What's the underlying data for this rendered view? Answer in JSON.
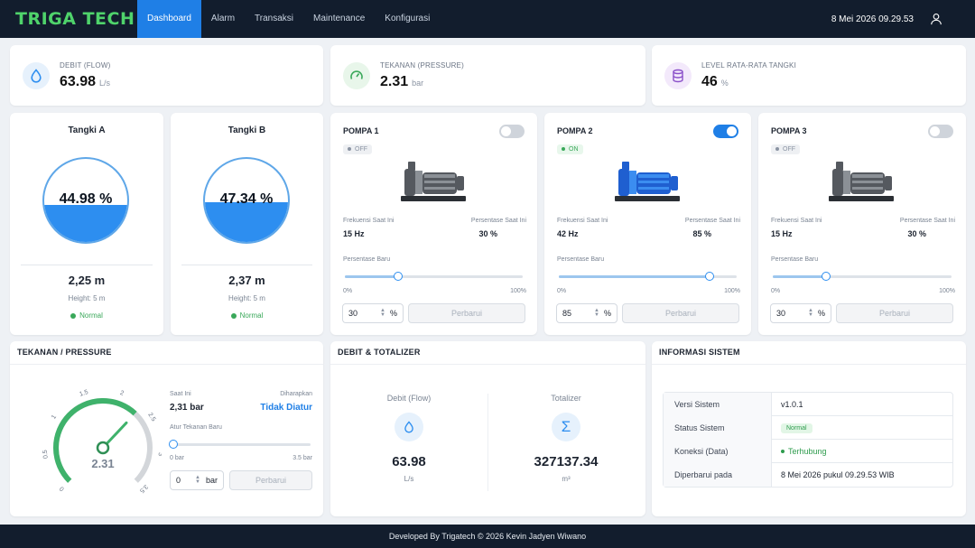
{
  "nav": {
    "brand": "TRIGA TECH",
    "items": [
      "Dashboard",
      "Alarm",
      "Transaksi",
      "Maintenance",
      "Konfigurasi"
    ],
    "datetime": "8 Mei 2026 09.29.53"
  },
  "stats": [
    {
      "label": "DEBIT (FLOW)",
      "value": "63.98",
      "unit": "L/s",
      "icon": "droplet-icon",
      "color": "#2d8ef0"
    },
    {
      "label": "TEKANAN (PRESSURE)",
      "value": "2.31",
      "unit": "bar",
      "icon": "gauge-icon",
      "color": "#3aa85a"
    },
    {
      "label": "LEVEL RATA-RATA TANGKI",
      "value": "46",
      "unit": "%",
      "icon": "database-icon",
      "color": "#8a4fc9"
    }
  ],
  "tanks": [
    {
      "title": "Tangki A",
      "percent": "44.98 %",
      "level": 0.4498,
      "height": "2,25 m",
      "capacity": "Height: 5 m",
      "status": "Normal"
    },
    {
      "title": "Tangki B",
      "percent": "47.34 %",
      "level": 0.4734,
      "height": "2,37 m",
      "capacity": "Height: 5 m",
      "status": "Normal"
    }
  ],
  "pumps": [
    {
      "title": "POMPA 1",
      "state": "OFF",
      "on": false,
      "freq_label": "Frekuensi Saat Ini",
      "freq": "15 Hz",
      "pct_label": "Persentase Saat Ini",
      "pct": "30 %",
      "new_label": "Persentase Baru",
      "slider": 0.3,
      "min": "0%",
      "max": "100%",
      "input": "30",
      "unit": "%",
      "button": "Perbarui"
    },
    {
      "title": "POMPA 2",
      "state": "ON",
      "on": true,
      "freq_label": "Frekuensi Saat Ini",
      "freq": "42 Hz",
      "pct_label": "Persentase Saat Ini",
      "pct": "85 %",
      "new_label": "Persentase Baru",
      "slider": 0.85,
      "min": "0%",
      "max": "100%",
      "input": "85",
      "unit": "%",
      "button": "Perbarui"
    },
    {
      "title": "POMPA 3",
      "state": "OFF",
      "on": false,
      "freq_label": "Frekuensi Saat Ini",
      "freq": "15 Hz",
      "pct_label": "Persentase Saat Ini",
      "pct": "30 %",
      "new_label": "Persentase Baru",
      "slider": 0.3,
      "min": "0%",
      "max": "100%",
      "input": "30",
      "unit": "%",
      "button": "Perbarui"
    }
  ],
  "pressure": {
    "title": "TEKANAN / PRESSURE",
    "gauge_value": "2.31",
    "value": 2.31,
    "gauge_max": 3.5,
    "ticks": [
      "0",
      "0.5",
      "1",
      "1.5",
      "2",
      "2.5",
      "3",
      "3.5"
    ],
    "current_label": "Saat Ini",
    "current": "2,31 bar",
    "expected_label": "Diharapkan",
    "expected": "Tidak Diatur",
    "set_label": "Atur Tekanan Baru",
    "slider_min": "0 bar",
    "slider_max": "3.5 bar",
    "slider": 0,
    "input": "0",
    "unit": "bar",
    "button": "Perbarui"
  },
  "debit": {
    "title": "DEBIT & TOTALIZER",
    "flow_label": "Debit (Flow)",
    "flow_value": "63.98",
    "flow_unit": "L/s",
    "total_label": "Totalizer",
    "total_value": "327137.34",
    "total_unit": "m³",
    "sigma": "Σ"
  },
  "info": {
    "title": "INFORMASI SISTEM",
    "rows": [
      {
        "key": "Versi Sistem",
        "value": "v1.0.1"
      },
      {
        "key": "Status Sistem",
        "value": "Normal"
      },
      {
        "key": "Koneksi (Data)",
        "value": "Terhubung"
      },
      {
        "key": "Diperbarui pada",
        "value": "8 Mei 2026 pukul 09.29.53 WIB"
      }
    ]
  },
  "footer": "Developed By Trigatech © 2026 Kevin Jadyen Wiwano"
}
